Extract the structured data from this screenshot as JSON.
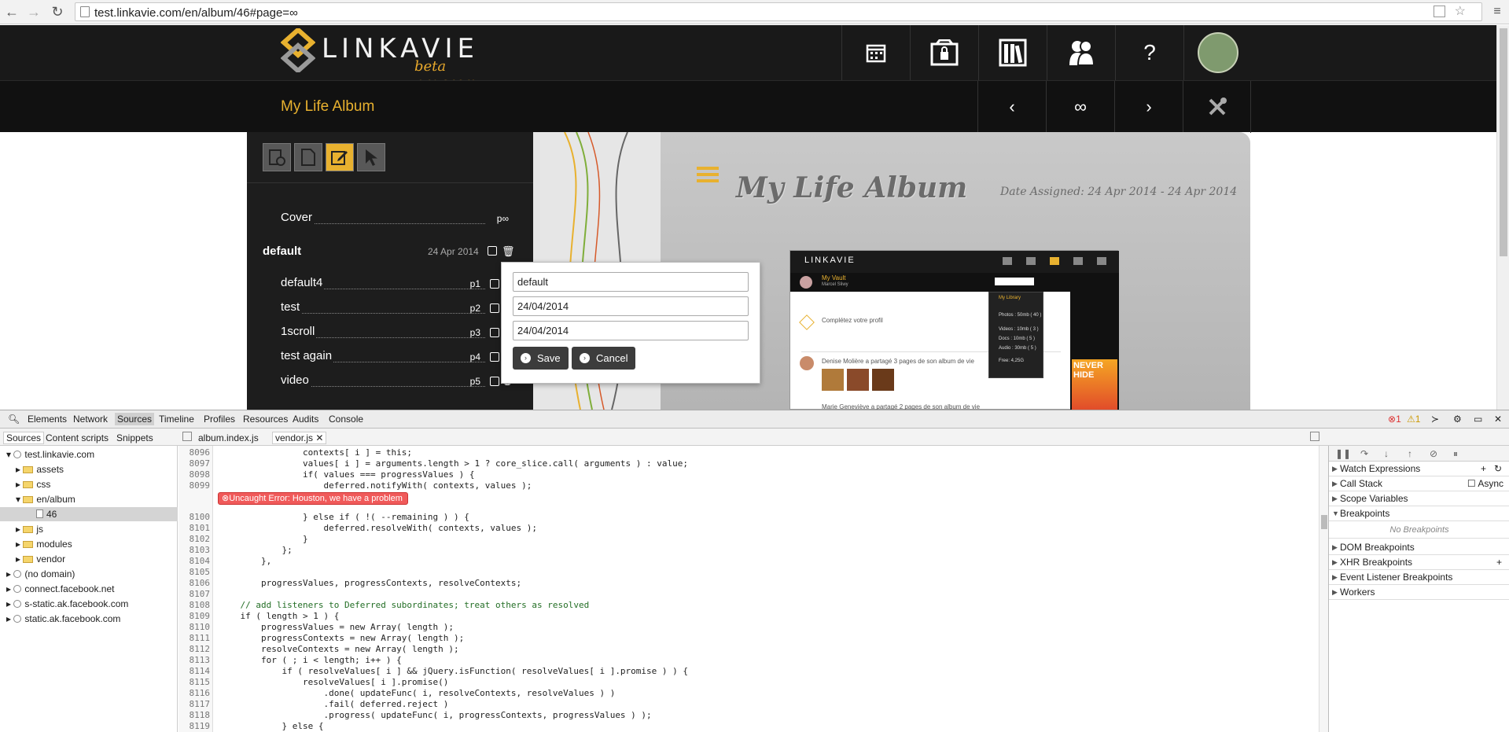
{
  "browser": {
    "url": "test.linkavie.com/en/album/46#page=∞"
  },
  "site": {
    "logo_word": "LINKAVIE",
    "logo_beta": "beta program",
    "album_title": "My Life Album",
    "infinity_label": "∞",
    "help_label": "?",
    "accent_color": "#e8b12f"
  },
  "panel": {
    "cover": {
      "label": "Cover",
      "page": "p∞"
    },
    "section": {
      "label": "default",
      "date": "24 Apr 2014"
    },
    "pages": [
      {
        "label": "default4",
        "page": "p1"
      },
      {
        "label": "test",
        "page": "p2"
      },
      {
        "label": "1scroll",
        "page": "p3"
      },
      {
        "label": "test again",
        "page": "p4"
      },
      {
        "label": "video",
        "page": "p5"
      }
    ]
  },
  "album": {
    "heading": "My Life Album",
    "date_assigned": "Date Assigned: 24 Apr 2014 - 24 Apr 2014",
    "preview": {
      "brand": "LINKAVIE",
      "user": "My Vault",
      "username": "Marcel Sliwy",
      "card_title": "Complétez votre profil",
      "post1": "Denise Molière a partagé 3 pages de son album de vie",
      "post2": "Marie Geneviève a partagé 2 pages de son album de vie",
      "ad_text": "NEVER HIDE",
      "menu_title": "My Library",
      "menu_items": [
        "Photos : 50mb ( 40 )",
        "Videos : 10mb ( 3 )",
        "Docs : 10mb ( 5 )",
        "Audio : 30mb ( 5 )",
        "Free: 4,25G"
      ]
    }
  },
  "dialog": {
    "name_value": "default",
    "date_from": "24/04/2014",
    "date_to": "24/04/2014",
    "save_label": "Save",
    "cancel_label": "Cancel"
  },
  "devtools": {
    "tabs": [
      "Elements",
      "Network",
      "Sources",
      "Timeline",
      "Profiles",
      "Resources",
      "Audits",
      "Console"
    ],
    "error_count": "1",
    "warning_count": "1",
    "subtabs": [
      "Sources",
      "Content scripts",
      "Snippets"
    ],
    "open_files": [
      "album.index.js",
      "vendor.js"
    ],
    "tree": [
      {
        "label": "test.linkavie.com",
        "kind": "globe",
        "depth": 0,
        "expanded": true
      },
      {
        "label": "assets",
        "kind": "folder",
        "depth": 1
      },
      {
        "label": "css",
        "kind": "folder",
        "depth": 1
      },
      {
        "label": "en/album",
        "kind": "folder",
        "depth": 1,
        "expanded": true
      },
      {
        "label": "46",
        "kind": "file",
        "depth": 2,
        "selected": true
      },
      {
        "label": "js",
        "kind": "folder",
        "depth": 1
      },
      {
        "label": "modules",
        "kind": "folder",
        "depth": 1
      },
      {
        "label": "vendor",
        "kind": "folder",
        "depth": 1
      },
      {
        "label": "(no domain)",
        "kind": "globe",
        "depth": 0
      },
      {
        "label": "connect.facebook.net",
        "kind": "globe",
        "depth": 0
      },
      {
        "label": "s-static.ak.facebook.com",
        "kind": "globe",
        "depth": 0
      },
      {
        "label": "static.ak.facebook.com",
        "kind": "globe",
        "depth": 0
      }
    ],
    "error_message": "Uncaught Error: Houston, we have a problem",
    "code_lines": [
      {
        "n": "8096",
        "t": "                contexts[ i ] = this;"
      },
      {
        "n": "8097",
        "t": "                values[ i ] = arguments.length > 1 ? core_slice.call( arguments ) : value;"
      },
      {
        "n": "8098",
        "t": "                if( values === progressValues ) {"
      },
      {
        "n": "8099",
        "t": "                    deferred.notifyWith( contexts, values );"
      },
      {
        "n": "",
        "t": ""
      },
      {
        "n": "8100",
        "t": "                } else if ( !( --remaining ) ) {"
      },
      {
        "n": "8101",
        "t": "                    deferred.resolveWith( contexts, values );"
      },
      {
        "n": "8102",
        "t": "                }"
      },
      {
        "n": "8103",
        "t": "            };"
      },
      {
        "n": "8104",
        "t": "        },"
      },
      {
        "n": "8105",
        "t": ""
      },
      {
        "n": "8106",
        "t": "        progressValues, progressContexts, resolveContexts;"
      },
      {
        "n": "8107",
        "t": ""
      },
      {
        "n": "8108",
        "t": "    // add listeners to Deferred subordinates; treat others as resolved"
      },
      {
        "n": "8109",
        "t": "    if ( length > 1 ) {"
      },
      {
        "n": "8110",
        "t": "        progressValues = new Array( length );"
      },
      {
        "n": "8111",
        "t": "        progressContexts = new Array( length );"
      },
      {
        "n": "8112",
        "t": "        resolveContexts = new Array( length );"
      },
      {
        "n": "8113",
        "t": "        for ( ; i < length; i++ ) {"
      },
      {
        "n": "8114",
        "t": "            if ( resolveValues[ i ] && jQuery.isFunction( resolveValues[ i ].promise ) ) {"
      },
      {
        "n": "8115",
        "t": "                resolveValues[ i ].promise()"
      },
      {
        "n": "8116",
        "t": "                    .done( updateFunc( i, resolveContexts, resolveValues ) )"
      },
      {
        "n": "8117",
        "t": "                    .fail( deferred.reject )"
      },
      {
        "n": "8118",
        "t": "                    .progress( updateFunc( i, progressContexts, progressValues ) );"
      },
      {
        "n": "8119",
        "t": "            } else {"
      }
    ],
    "right_panels": [
      "Watch Expressions",
      "Call Stack",
      "Scope Variables",
      "Breakpoints",
      "DOM Breakpoints",
      "XHR Breakpoints",
      "Event Listener Breakpoints",
      "Workers"
    ],
    "async_label": "Async",
    "no_breakpoints": "No Breakpoints"
  }
}
